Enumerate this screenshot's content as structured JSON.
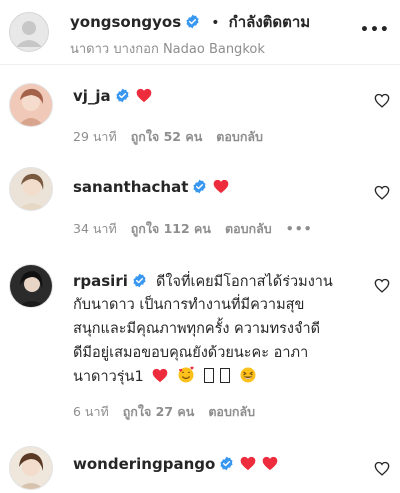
{
  "post_header": {
    "username": "yongsongyos",
    "separator": "•",
    "follow_status": "กำลังติดตาม",
    "location": "นาดาว บางกอก Nadao Bangkok",
    "more_label": "•••"
  },
  "comments": [
    {
      "username": "vj_ja",
      "verified": true,
      "text_emoji": "heart",
      "time": "29 นาที",
      "likes": "ถูกใจ 52 คน",
      "reply": "ตอบกลับ"
    },
    {
      "username": "sananthachat",
      "verified": true,
      "text_emoji": "heart",
      "time": "34 นาที",
      "likes": "ถูกใจ 112 คน",
      "reply": "ตอบกลับ",
      "more": "•••"
    },
    {
      "username": "rpasiri",
      "verified": true,
      "lines": [
        "ดีใจที่เคยมีโอกาสได้ร่วมงาน",
        "กับนาดาว เป็นการทำงานที่มีความสุข",
        "สนุกและมีคุณภาพทุกครั้ง ความทรงจำดี",
        "ดีมีอยู่เสมอขอบคุณยังด้วยนะคะ อาภา",
        "นาดาวรุ่น1"
      ],
      "emojis": [
        "red-heart",
        "smiling-face-with-hearts",
        "flag-placeholder",
        "flag-placeholder",
        "grinning-squinting-face"
      ],
      "time": "6 นาที",
      "likes": "ถูกใจ 27 คน",
      "reply": "ตอบกลับ"
    },
    {
      "username": "wonderingpango",
      "verified": true,
      "text_emoji": "two-hearts"
    }
  ],
  "colors": {
    "verified_blue": "#3897f0",
    "heart_red": "#ed4956",
    "text_primary": "#262626",
    "text_secondary": "#8e8e8e"
  }
}
